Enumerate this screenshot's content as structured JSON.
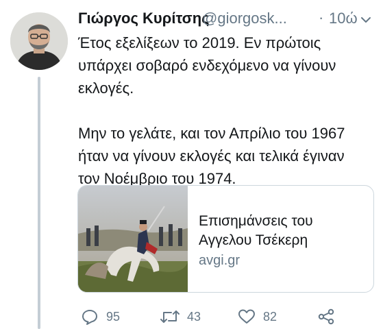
{
  "tweet": {
    "author_name": "Γιώργος Κυρίτσης",
    "handle": "@giorgosk...",
    "separator": "·",
    "time": "10ώ",
    "text": "Έτος εξελίξεων το 2019. Εν πρώτοις υπάρχει σοβαρό ενδεχόμενο να γίνουν εκλογές.\n\nΜην το γελάτε, και τον Απρίλιο του 1967 ήταν να γίνουν εκλογές και τελικά έγιναν τον Νοέμβριο του 1974."
  },
  "card": {
    "title_line1": "Επισημάνσεις του",
    "title_line2": "Αγγελου Τσέκερη",
    "domain": "avgi.gr"
  },
  "actions": {
    "replies": "95",
    "retweets": "43",
    "likes": "82"
  },
  "icons": {
    "menu": "chevron-down-icon",
    "reply": "reply-icon",
    "retweet": "retweet-icon",
    "like": "heart-icon",
    "share": "share-icon"
  },
  "colors": {
    "text": "#14171a",
    "secondary": "#657786",
    "border": "#ccd6dd",
    "thread_line": "#c4cdd5"
  }
}
